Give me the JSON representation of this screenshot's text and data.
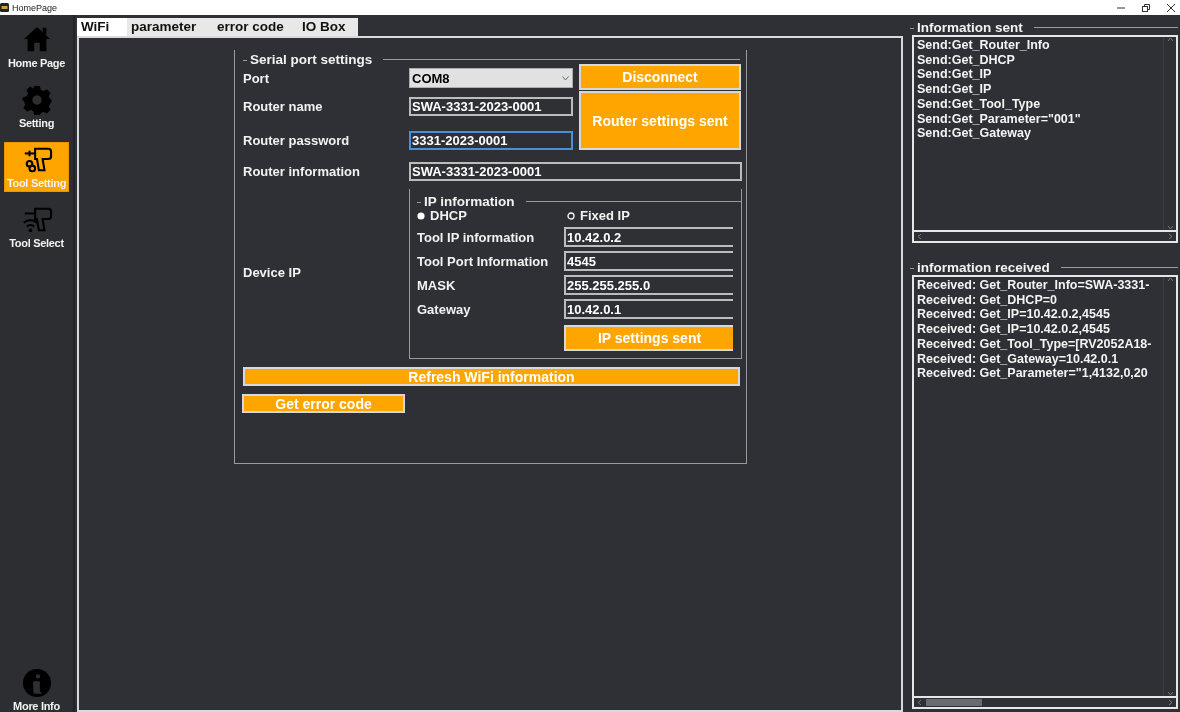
{
  "window": {
    "title": "HomePage"
  },
  "sidebar": {
    "items": [
      {
        "label": "Home Page",
        "kind": "home",
        "selected": false
      },
      {
        "label": "Setting",
        "kind": "gear",
        "selected": false
      },
      {
        "label": "Tool Setting",
        "kind": "drill",
        "selected": true
      },
      {
        "label": "Tool Select",
        "kind": "drill-wifi",
        "selected": false
      }
    ],
    "footer": {
      "label": "More Info",
      "kind": "info",
      "selected": false
    }
  },
  "tabs": [
    {
      "label": "WiFi",
      "selected": true
    },
    {
      "label": "parameter",
      "selected": false
    },
    {
      "label": "error code",
      "selected": false
    },
    {
      "label": "IO Box",
      "selected": false
    }
  ],
  "serial_port_settings": {
    "title": "Serial port settings",
    "port": {
      "label": "Port",
      "value": "COM8"
    },
    "disconnect_button": "Disconnect",
    "router_name": {
      "label": "Router name",
      "value": "SWA-3331-2023-0001",
      "focused": false
    },
    "router_password": {
      "label": "Router password",
      "value": "3331-2023-0001",
      "focused": true
    },
    "router_settings_button": "Router settings sent",
    "router_information": {
      "label": "Router information",
      "value": "SWA-3331-2023-0001",
      "focused": false
    },
    "device_ip_label": "Device IP",
    "ip_information": {
      "title": "IP information",
      "modes": [
        {
          "label": "DHCP",
          "selected": true
        },
        {
          "label": "Fixed IP",
          "selected": false
        }
      ],
      "fields": [
        {
          "label": "Tool IP information",
          "value": "10.42.0.2"
        },
        {
          "label": "Tool Port Information",
          "value": "4545"
        },
        {
          "label": "MASK",
          "value": "255.255.255.0"
        },
        {
          "label": "Gateway",
          "value": "10.42.0.1"
        }
      ],
      "button": "IP settings sent"
    },
    "refresh_button": "Refresh WiFi information",
    "error_code_button": "Get error code"
  },
  "information_sent": {
    "title": "Information sent",
    "lines": [
      "Send:Get_Router_Info",
      "Send:Get_DHCP",
      "Send:Get_IP",
      "Send:Get_IP",
      "Send:Get_Tool_Type",
      "Send:Get_Parameter=\"001\"",
      "Send:Get_Gateway"
    ]
  },
  "information_received": {
    "title": "information received",
    "lines": [
      "Received: Get_Router_Info=SWA-3331-",
      "Received: Get_DHCP=0",
      "Received: Get_IP=10.42.0.2,4545",
      "Received: Get_IP=10.42.0.2,4545",
      "Received: Get_Tool_Type=[RV2052A18-",
      "Received: Get_Gateway=10.42.0.1",
      "Received: Get_Parameter=\"1,4132,0,20"
    ]
  }
}
